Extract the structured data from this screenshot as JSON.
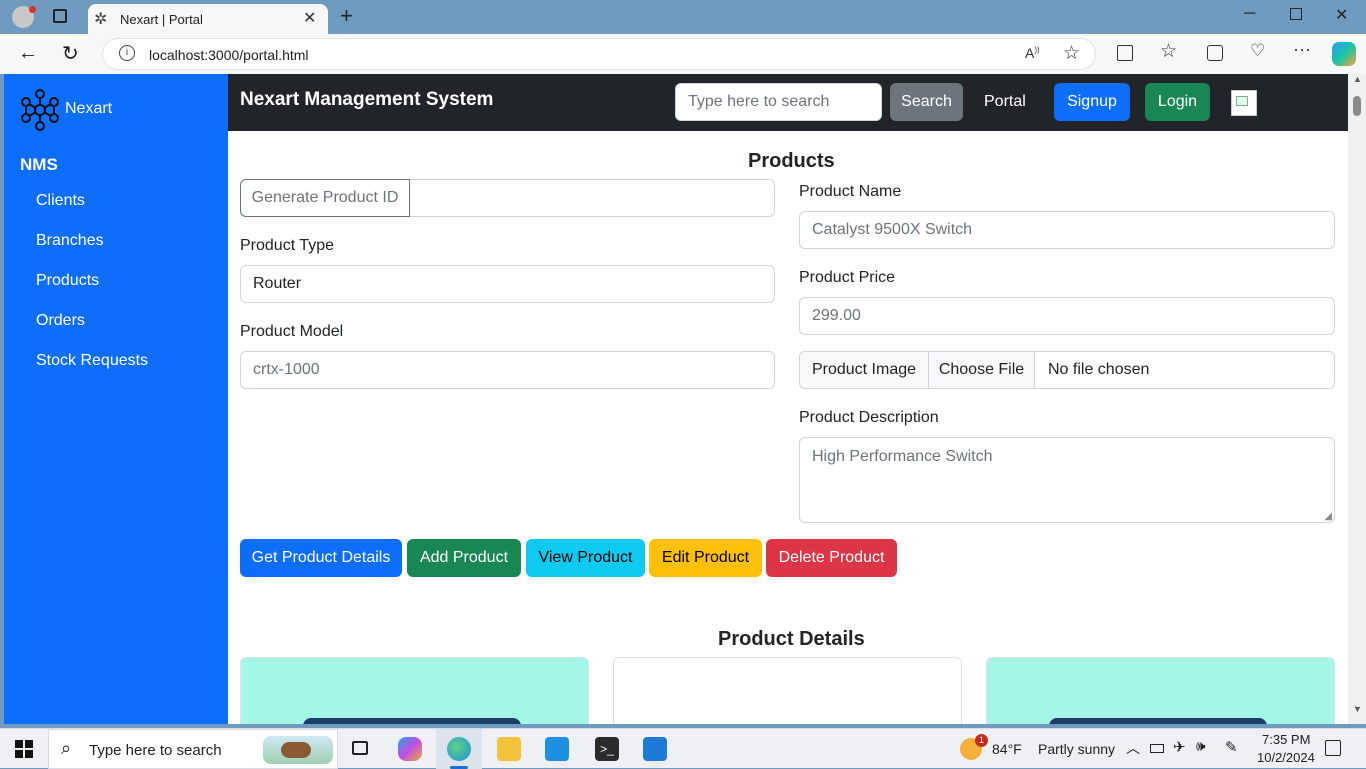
{
  "browser": {
    "tab_title": "Nexart | Portal",
    "url": "localhost:3000/portal.html"
  },
  "sidebar": {
    "brand": "Nexart",
    "section": "NMS",
    "items": [
      {
        "label": "Clients"
      },
      {
        "label": "Branches"
      },
      {
        "label": "Products"
      },
      {
        "label": "Orders"
      },
      {
        "label": "Stock Requests"
      }
    ]
  },
  "navbar": {
    "title": "Nexart Management System",
    "search_placeholder": "Type here to search",
    "search_label": "Search",
    "portal_label": "Portal",
    "signup_label": "Signup",
    "login_label": "Login"
  },
  "products": {
    "heading": "Products",
    "generate_id_label": "Generate Product ID",
    "product_id_value": "",
    "product_type_label": "Product Type",
    "product_type_value": "Router",
    "product_model_label": "Product Model",
    "product_model_placeholder": "crtx-1000",
    "product_name_label": "Product Name",
    "product_name_placeholder": "Catalyst 9500X Switch",
    "product_price_label": "Product Price",
    "product_price_placeholder": "299.00",
    "product_image_label": "Product Image",
    "choose_file_label": "Choose File",
    "no_file_text": "No file chosen",
    "product_description_label": "Product Description",
    "product_description_placeholder": "High Performance Switch",
    "buttons": {
      "get_details": "Get Product Details",
      "add": "Add Product",
      "view": "View Product",
      "edit": "Edit Product",
      "delete": "Delete Product"
    },
    "details_heading": "Product Details"
  },
  "taskbar": {
    "search_placeholder": "Type here to search",
    "weather_temp": "84°F",
    "weather_desc": "Partly sunny",
    "weather_badge": "1",
    "time": "7:35 PM",
    "date": "10/2/2024"
  },
  "colors": {
    "primary": "#0d6efd",
    "success": "#198754",
    "info": "#0dcaf0",
    "warning": "#ffc107",
    "danger": "#dc3545",
    "secondary": "#6c757d",
    "dark": "#212529",
    "card_teal": "#a4f6e6"
  }
}
